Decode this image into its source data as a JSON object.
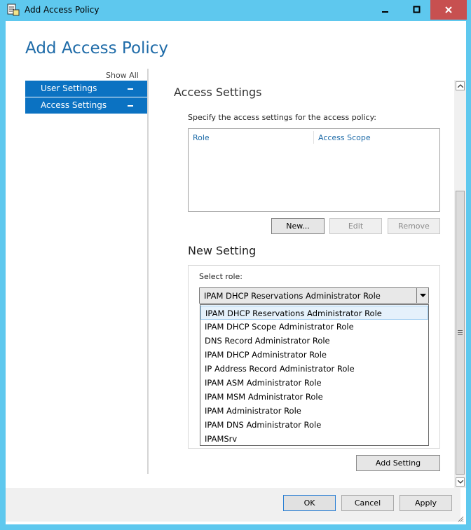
{
  "window": {
    "title": "Add Access Policy"
  },
  "page": {
    "title": "Add Access Policy"
  },
  "sidebar": {
    "show_all": "Show All",
    "items": [
      {
        "label": "User Settings"
      },
      {
        "label": "Access Settings"
      }
    ]
  },
  "access_settings": {
    "title": "Access Settings",
    "instruction": "Specify the access settings for the access policy:",
    "columns": [
      "Role",
      "Access Scope"
    ],
    "buttons": {
      "new": "New...",
      "edit": "Edit",
      "remove": "Remove"
    }
  },
  "new_setting": {
    "title": "New Setting",
    "select_label": "Select role:",
    "selected_role": "IPAM DHCP Reservations Administrator Role",
    "options": [
      "IPAM DHCP Reservations Administrator Role",
      "IPAM DHCP Scope Administrator Role",
      "DNS Record Administrator Role",
      "IPAM DHCP Administrator Role",
      "IP Address Record Administrator Role",
      "IPAM ASM Administrator Role",
      "IPAM MSM Administrator Role",
      "IPAM Administrator Role",
      "IPAM DNS Administrator Role",
      "IPAMSrv"
    ],
    "add_button": "Add Setting"
  },
  "footer": {
    "ok": "OK",
    "cancel": "Cancel",
    "apply": "Apply"
  },
  "colors": {
    "titlebar": "#5ec8ee",
    "accent": "#0b72c2",
    "title_text": "#1e6ba8",
    "close": "#c75050"
  }
}
